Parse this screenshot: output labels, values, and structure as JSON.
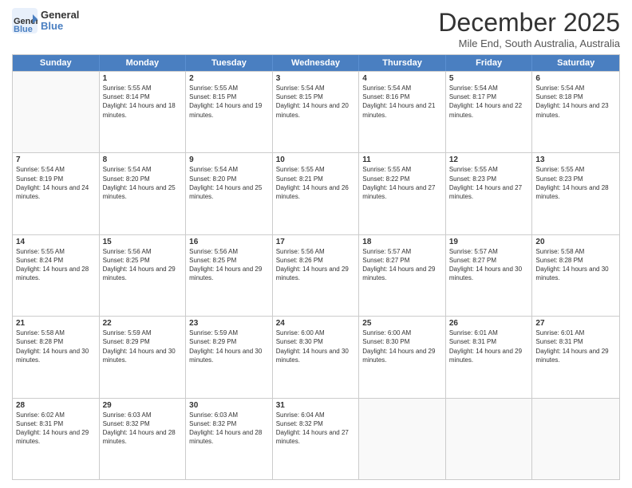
{
  "logo": {
    "general": "General",
    "blue": "Blue"
  },
  "title": "December 2025",
  "location": "Mile End, South Australia, Australia",
  "days_header": [
    "Sunday",
    "Monday",
    "Tuesday",
    "Wednesday",
    "Thursday",
    "Friday",
    "Saturday"
  ],
  "weeks": [
    [
      {
        "day": "",
        "sunrise": "",
        "sunset": "",
        "daylight": "",
        "empty": true
      },
      {
        "day": "1",
        "sunrise": "Sunrise: 5:55 AM",
        "sunset": "Sunset: 8:14 PM",
        "daylight": "Daylight: 14 hours and 18 minutes."
      },
      {
        "day": "2",
        "sunrise": "Sunrise: 5:55 AM",
        "sunset": "Sunset: 8:15 PM",
        "daylight": "Daylight: 14 hours and 19 minutes."
      },
      {
        "day": "3",
        "sunrise": "Sunrise: 5:54 AM",
        "sunset": "Sunset: 8:15 PM",
        "daylight": "Daylight: 14 hours and 20 minutes."
      },
      {
        "day": "4",
        "sunrise": "Sunrise: 5:54 AM",
        "sunset": "Sunset: 8:16 PM",
        "daylight": "Daylight: 14 hours and 21 minutes."
      },
      {
        "day": "5",
        "sunrise": "Sunrise: 5:54 AM",
        "sunset": "Sunset: 8:17 PM",
        "daylight": "Daylight: 14 hours and 22 minutes."
      },
      {
        "day": "6",
        "sunrise": "Sunrise: 5:54 AM",
        "sunset": "Sunset: 8:18 PM",
        "daylight": "Daylight: 14 hours and 23 minutes."
      }
    ],
    [
      {
        "day": "7",
        "sunrise": "Sunrise: 5:54 AM",
        "sunset": "Sunset: 8:19 PM",
        "daylight": "Daylight: 14 hours and 24 minutes."
      },
      {
        "day": "8",
        "sunrise": "Sunrise: 5:54 AM",
        "sunset": "Sunset: 8:20 PM",
        "daylight": "Daylight: 14 hours and 25 minutes."
      },
      {
        "day": "9",
        "sunrise": "Sunrise: 5:54 AM",
        "sunset": "Sunset: 8:20 PM",
        "daylight": "Daylight: 14 hours and 25 minutes."
      },
      {
        "day": "10",
        "sunrise": "Sunrise: 5:55 AM",
        "sunset": "Sunset: 8:21 PM",
        "daylight": "Daylight: 14 hours and 26 minutes."
      },
      {
        "day": "11",
        "sunrise": "Sunrise: 5:55 AM",
        "sunset": "Sunset: 8:22 PM",
        "daylight": "Daylight: 14 hours and 27 minutes."
      },
      {
        "day": "12",
        "sunrise": "Sunrise: 5:55 AM",
        "sunset": "Sunset: 8:23 PM",
        "daylight": "Daylight: 14 hours and 27 minutes."
      },
      {
        "day": "13",
        "sunrise": "Sunrise: 5:55 AM",
        "sunset": "Sunset: 8:23 PM",
        "daylight": "Daylight: 14 hours and 28 minutes."
      }
    ],
    [
      {
        "day": "14",
        "sunrise": "Sunrise: 5:55 AM",
        "sunset": "Sunset: 8:24 PM",
        "daylight": "Daylight: 14 hours and 28 minutes."
      },
      {
        "day": "15",
        "sunrise": "Sunrise: 5:56 AM",
        "sunset": "Sunset: 8:25 PM",
        "daylight": "Daylight: 14 hours and 29 minutes."
      },
      {
        "day": "16",
        "sunrise": "Sunrise: 5:56 AM",
        "sunset": "Sunset: 8:25 PM",
        "daylight": "Daylight: 14 hours and 29 minutes."
      },
      {
        "day": "17",
        "sunrise": "Sunrise: 5:56 AM",
        "sunset": "Sunset: 8:26 PM",
        "daylight": "Daylight: 14 hours and 29 minutes."
      },
      {
        "day": "18",
        "sunrise": "Sunrise: 5:57 AM",
        "sunset": "Sunset: 8:27 PM",
        "daylight": "Daylight: 14 hours and 29 minutes."
      },
      {
        "day": "19",
        "sunrise": "Sunrise: 5:57 AM",
        "sunset": "Sunset: 8:27 PM",
        "daylight": "Daylight: 14 hours and 30 minutes."
      },
      {
        "day": "20",
        "sunrise": "Sunrise: 5:58 AM",
        "sunset": "Sunset: 8:28 PM",
        "daylight": "Daylight: 14 hours and 30 minutes."
      }
    ],
    [
      {
        "day": "21",
        "sunrise": "Sunrise: 5:58 AM",
        "sunset": "Sunset: 8:28 PM",
        "daylight": "Daylight: 14 hours and 30 minutes."
      },
      {
        "day": "22",
        "sunrise": "Sunrise: 5:59 AM",
        "sunset": "Sunset: 8:29 PM",
        "daylight": "Daylight: 14 hours and 30 minutes."
      },
      {
        "day": "23",
        "sunrise": "Sunrise: 5:59 AM",
        "sunset": "Sunset: 8:29 PM",
        "daylight": "Daylight: 14 hours and 30 minutes."
      },
      {
        "day": "24",
        "sunrise": "Sunrise: 6:00 AM",
        "sunset": "Sunset: 8:30 PM",
        "daylight": "Daylight: 14 hours and 30 minutes."
      },
      {
        "day": "25",
        "sunrise": "Sunrise: 6:00 AM",
        "sunset": "Sunset: 8:30 PM",
        "daylight": "Daylight: 14 hours and 29 minutes."
      },
      {
        "day": "26",
        "sunrise": "Sunrise: 6:01 AM",
        "sunset": "Sunset: 8:31 PM",
        "daylight": "Daylight: 14 hours and 29 minutes."
      },
      {
        "day": "27",
        "sunrise": "Sunrise: 6:01 AM",
        "sunset": "Sunset: 8:31 PM",
        "daylight": "Daylight: 14 hours and 29 minutes."
      }
    ],
    [
      {
        "day": "28",
        "sunrise": "Sunrise: 6:02 AM",
        "sunset": "Sunset: 8:31 PM",
        "daylight": "Daylight: 14 hours and 29 minutes."
      },
      {
        "day": "29",
        "sunrise": "Sunrise: 6:03 AM",
        "sunset": "Sunset: 8:32 PM",
        "daylight": "Daylight: 14 hours and 28 minutes."
      },
      {
        "day": "30",
        "sunrise": "Sunrise: 6:03 AM",
        "sunset": "Sunset: 8:32 PM",
        "daylight": "Daylight: 14 hours and 28 minutes."
      },
      {
        "day": "31",
        "sunrise": "Sunrise: 6:04 AM",
        "sunset": "Sunset: 8:32 PM",
        "daylight": "Daylight: 14 hours and 27 minutes."
      },
      {
        "day": "",
        "sunrise": "",
        "sunset": "",
        "daylight": "",
        "empty": true
      },
      {
        "day": "",
        "sunrise": "",
        "sunset": "",
        "daylight": "",
        "empty": true
      },
      {
        "day": "",
        "sunrise": "",
        "sunset": "",
        "daylight": "",
        "empty": true
      }
    ]
  ]
}
